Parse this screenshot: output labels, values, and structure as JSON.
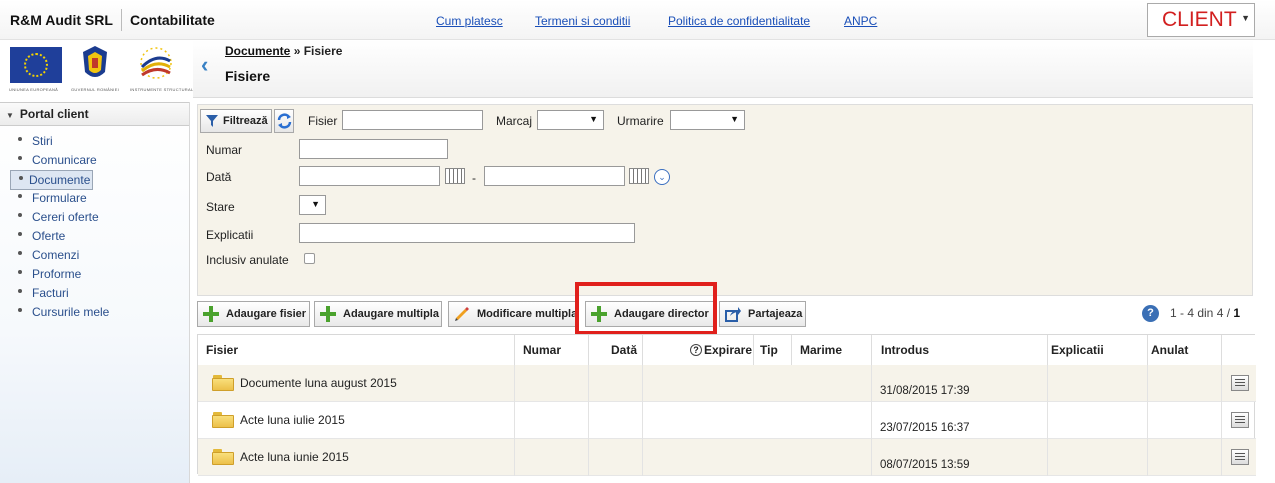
{
  "header": {
    "company": "R&M Audit SRL",
    "app": "Contabilitate",
    "links": [
      "Cum platesc",
      "Termeni si conditii",
      "Politica de confidentialitate",
      "ANPC"
    ],
    "client_button": "CLIENT"
  },
  "logos": {
    "captions": [
      "UNIUNEA EUROPEANĂ",
      "GUVERNUL ROMÂNIEI",
      "INSTRUMENTE STRUCTURALE"
    ]
  },
  "sidebar": {
    "title": "Portal client",
    "items": [
      "Stiri",
      "Comunicare",
      "Documente",
      "Formulare",
      "Cereri oferte",
      "Oferte",
      "Comenzi",
      "Proforme",
      "Facturi",
      "Cursurile mele"
    ],
    "active": "Documente"
  },
  "breadcrumb": {
    "parent": "Documente",
    "sep": "»",
    "current": "Fisiere"
  },
  "page_title": "Fisiere",
  "filter": {
    "filter_button": "Filtrează",
    "labels": {
      "fisier": "Fisier",
      "marcaj": "Marcaj",
      "urmarire": "Urmarire",
      "numar": "Numar",
      "data": "Dată",
      "range_sep": "-",
      "stare": "Stare",
      "explicatii": "Explicatii",
      "inclusiv_anulate": "Inclusiv anulate"
    }
  },
  "toolbar": {
    "buttons": [
      "Adaugare fisier",
      "Adaugare multipla",
      "Modificare multipla",
      "Adaugare director",
      "Partajeaza"
    ],
    "pager_text": "1 - 4 din 4 /",
    "pager_page": "1"
  },
  "table": {
    "columns": [
      "Fisier",
      "Numar",
      "Dată",
      "Expirare",
      "Tip",
      "Marime",
      "Introdus",
      "Explicatii",
      "Anulat"
    ],
    "rows": [
      {
        "name": "Documente luna august 2015",
        "introdus": "31/08/2015 17:39"
      },
      {
        "name": "Acte luna iulie 2015",
        "introdus": "23/07/2015 16:37"
      },
      {
        "name": "Acte luna iunie 2015",
        "introdus": "08/07/2015 13:59"
      }
    ]
  },
  "colors": {
    "link": "#1a4fb8",
    "client": "#d21f1f",
    "highlight": "#e0201c",
    "filter_bg": "#f6f3ea"
  }
}
